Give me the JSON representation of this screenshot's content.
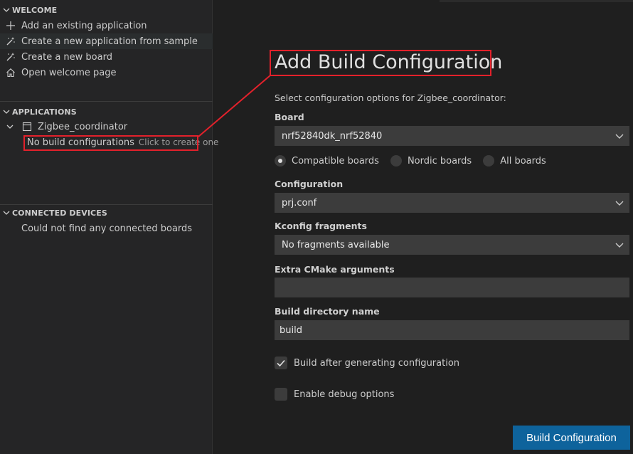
{
  "sidebar": {
    "welcome": {
      "header": "WELCOME",
      "items": [
        {
          "label": "Add an existing application",
          "icon": "plus-icon"
        },
        {
          "label": "Create a new application from sample",
          "icon": "magic-wand-icon"
        },
        {
          "label": "Create a new board",
          "icon": "magic-wand-icon"
        },
        {
          "label": "Open welcome page",
          "icon": "home-icon"
        }
      ]
    },
    "applications": {
      "header": "APPLICATIONS",
      "app_name": "Zigbee_coordinator",
      "no_builds_label": "No build configurations",
      "no_builds_hint": "Click to create one"
    },
    "connected_devices": {
      "header": "CONNECTED DEVICES",
      "message": "Could not find any connected boards"
    }
  },
  "form": {
    "title": "Add Build Configuration",
    "subtitle": "Select configuration options for Zigbee_coordinator:",
    "board": {
      "label": "Board",
      "value": "nrf52840dk_nrf52840",
      "filters": [
        {
          "label": "Compatible boards",
          "selected": true
        },
        {
          "label": "Nordic boards",
          "selected": false
        },
        {
          "label": "All boards",
          "selected": false
        }
      ]
    },
    "configuration": {
      "label": "Configuration",
      "value": "prj.conf"
    },
    "kconfig": {
      "label": "Kconfig fragments",
      "value": "No fragments available"
    },
    "cmake": {
      "label": "Extra CMake arguments",
      "value": ""
    },
    "build_dir": {
      "label": "Build directory name",
      "value": "build"
    },
    "build_after": {
      "label": "Build after generating configuration",
      "checked": true
    },
    "debug": {
      "label": "Enable debug options",
      "checked": false
    },
    "submit_label": "Build Configuration"
  },
  "colors": {
    "annotation": "#e3212b",
    "primary_button": "#0e639c",
    "background": "#1f1f1f",
    "sidebar": "#252526"
  }
}
